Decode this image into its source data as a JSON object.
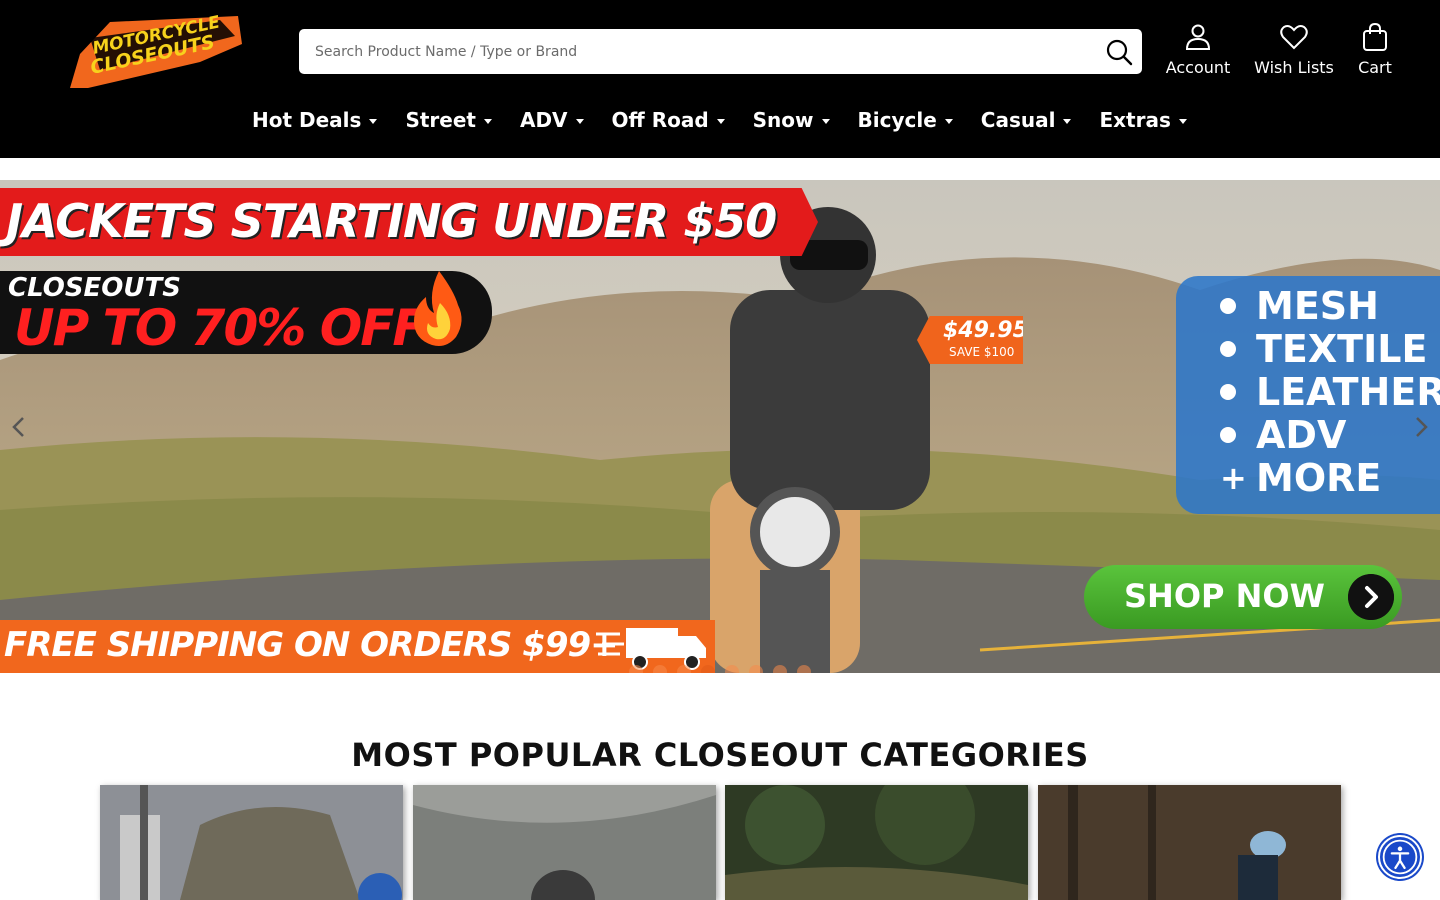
{
  "header": {
    "logo_text": "MOTORCYCLE CLOSEOUTS.COM",
    "search": {
      "placeholder": "Search Product Name / Type or Brand",
      "value": ""
    },
    "account_label": "Account",
    "wishlist_label": "Wish Lists",
    "cart_label": "Cart"
  },
  "nav": {
    "items": [
      {
        "label": "Hot Deals"
      },
      {
        "label": "Street"
      },
      {
        "label": "ADV"
      },
      {
        "label": "Off Road"
      },
      {
        "label": "Snow"
      },
      {
        "label": "Bicycle"
      },
      {
        "label": "Casual"
      },
      {
        "label": "Extras"
      }
    ]
  },
  "hero": {
    "headline": "JACKETS STARTING UNDER $50",
    "closeouts_label": "CLOSEOUTS",
    "discount_label": "UP TO 70% OFF",
    "price": "$49.95",
    "save": "SAVE $100",
    "types": [
      "MESH",
      "TEXTILE",
      "LEATHER",
      "ADV"
    ],
    "more_label": "MORE",
    "cta_label": "SHOP NOW",
    "shipping_label": "FREE SHIPPING ON ORDERS $99+",
    "slides_count": 8,
    "active_slide": 4
  },
  "categories": {
    "title": "MOST POPULAR CLOSEOUT CATEGORIES"
  },
  "colors": {
    "accent_orange": "#f1671d",
    "banner_red": "#e31b1b",
    "header_bg": "#000000",
    "cta_green": "#3a9a22",
    "accessibility_blue": "#1a49c9"
  }
}
